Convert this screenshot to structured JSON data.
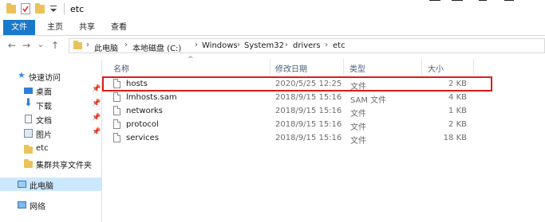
{
  "window": {
    "title": "etc",
    "quick_access_icons": [
      "folder-icon",
      "properties-check-icon",
      "new-folder-icon",
      "customize-dropdown-icon"
    ]
  },
  "ribbon": {
    "tabs": [
      "文件",
      "主页",
      "共享",
      "查看"
    ],
    "active_tab": "文件",
    "accent": "#1979ca"
  },
  "address": {
    "back": "←",
    "forward": "→",
    "recent": "⌄",
    "up": "↑",
    "breadcrumbs": [
      "此电脑",
      "本地磁盘 (C:)",
      "Windows",
      "System32",
      "drivers",
      "etc"
    ],
    "separator": "›"
  },
  "nav": {
    "items": [
      {
        "label": "快速访问",
        "icon": "star-icon",
        "pinned": false
      },
      {
        "label": "桌面",
        "icon": "desktop-icon",
        "pinned": true
      },
      {
        "label": "下载",
        "icon": "download-icon",
        "pinned": true
      },
      {
        "label": "文档",
        "icon": "document-icon",
        "pinned": true
      },
      {
        "label": "图片",
        "icon": "picture-icon",
        "pinned": true
      },
      {
        "label": "etc",
        "icon": "folder-icon",
        "pinned": false
      },
      {
        "label": "集群共享文件夹",
        "icon": "folder-icon",
        "pinned": false
      },
      {
        "label": "此电脑",
        "icon": "computer-icon",
        "pinned": false,
        "selected": true
      },
      {
        "label": "网络",
        "icon": "network-icon",
        "pinned": false
      }
    ],
    "pin_glyph": "📌"
  },
  "list": {
    "sort_glyph": "^",
    "columns": [
      "名称",
      "修改日期",
      "类型",
      "大小"
    ],
    "files": [
      {
        "name": "hosts",
        "modified": "2020/5/25 12:25",
        "type": "文件",
        "size": "2 KB",
        "highlighted": true
      },
      {
        "name": "lmhosts.sam",
        "modified": "2018/9/15 15:16",
        "type": "SAM 文件",
        "size": "4 KB"
      },
      {
        "name": "networks",
        "modified": "2018/9/15 15:16",
        "type": "文件",
        "size": "1 KB"
      },
      {
        "name": "protocol",
        "modified": "2018/9/15 15:16",
        "type": "文件",
        "size": "2 KB"
      },
      {
        "name": "services",
        "modified": "2018/9/15 15:16",
        "type": "文件",
        "size": "18 KB"
      }
    ],
    "highlight_color": "#e01a1a"
  }
}
